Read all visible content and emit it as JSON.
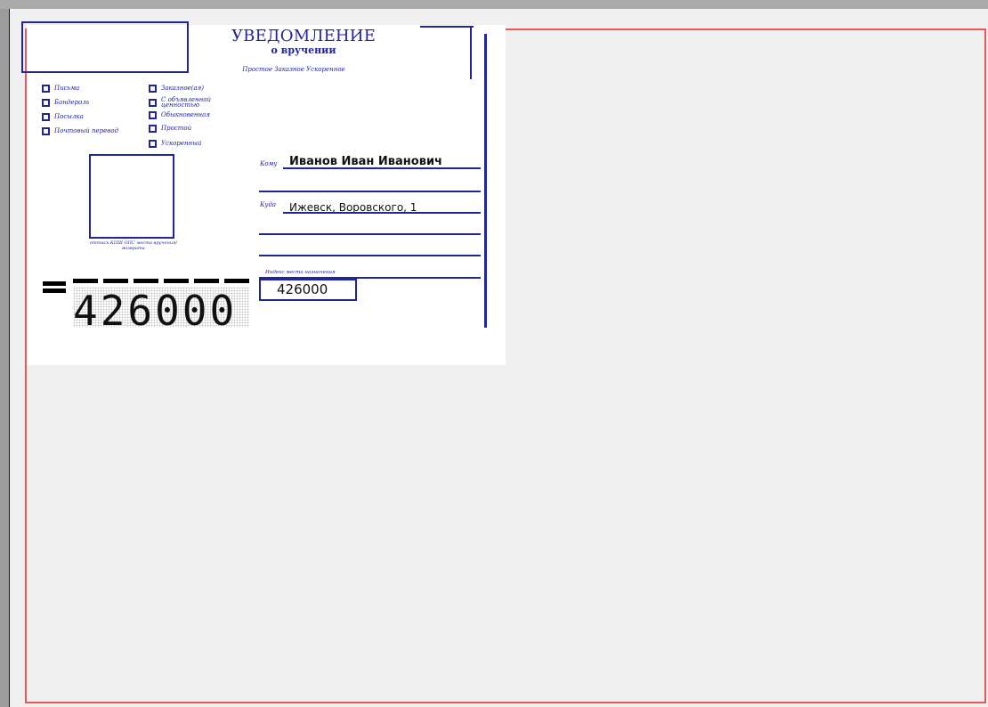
{
  "notice": {
    "title": "УВЕДОМЛЕНИЕ",
    "subtitle": "о вручении",
    "delivery_types": "Простое Заказное Ускоренное"
  },
  "mail_types_left": [
    {
      "label": "Письма"
    },
    {
      "label": "Бандероль"
    },
    {
      "label": "Посылка"
    },
    {
      "label": "Почтовый перевод"
    }
  ],
  "mail_types_right": [
    {
      "label": "Заказное(ая)"
    },
    {
      "label": "С объявленной ценностью"
    },
    {
      "label": "Обыкновенная"
    },
    {
      "label": "Простой"
    },
    {
      "label": "Ускоренный"
    }
  ],
  "stamp": {
    "caption": "оттиск КПШ ОПС места вручения/возврата"
  },
  "recipient": {
    "to_label": "Кому",
    "name": "Иванов Иван Иванович",
    "where_label": "Куда",
    "address": "Ижевск, Воровского, 1",
    "index_label": "Индекс места назначения",
    "index_value": "426000"
  },
  "postal_code_digits": "426000",
  "colors": {
    "ink_blue": "#22249a",
    "frame_red": "#e8575a",
    "canvas": "#f0f0f0"
  }
}
